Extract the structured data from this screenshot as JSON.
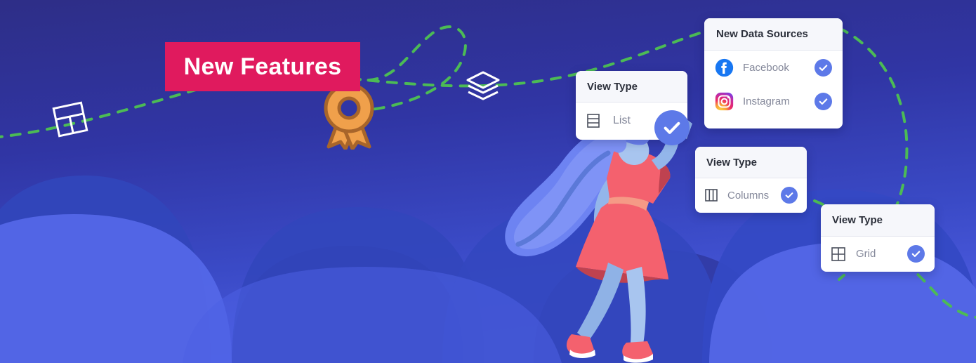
{
  "banner": {
    "label": "New Features",
    "color": "#e01a5e",
    "text_color": "#ffffff"
  },
  "theme": {
    "background_top": "#2e2e87",
    "background_bottom": "#4254d8",
    "path_color": "#4cbb55",
    "check_color": "#5d79e8",
    "card_background": "#ffffff",
    "card_header_background": "#f6f7fb",
    "label_color": "#84889a",
    "title_color": "#2b2f3a",
    "award_color": "#f0a04b",
    "award_outline": "#a8652a",
    "dress_color": "#f4616e",
    "hair_color": "#6d83f2",
    "skin_color": "#a8c5ef"
  },
  "decor": {
    "layout_icon": "layout-outline-icon",
    "layers_icon": "layers-outline-icon",
    "award_icon": "award-ribbon-icon",
    "path": "dashed-path"
  },
  "cards": {
    "data_sources": {
      "title": "New Data Sources",
      "items": [
        {
          "label": "Facebook",
          "icon": "facebook-icon",
          "checked": true
        },
        {
          "label": "Instagram",
          "icon": "instagram-icon",
          "checked": true
        }
      ]
    },
    "list_view": {
      "title": "View Type",
      "option_label": "List",
      "option_icon": "list-view-icon",
      "checked": true
    },
    "columns_view": {
      "title": "View Type",
      "option_label": "Columns",
      "option_icon": "columns-view-icon",
      "checked": true
    },
    "grid_view": {
      "title": "View Type",
      "option_label": "Grid",
      "option_icon": "grid-view-icon",
      "checked": true
    }
  },
  "illustration": {
    "name": "woman-character-illustration"
  }
}
